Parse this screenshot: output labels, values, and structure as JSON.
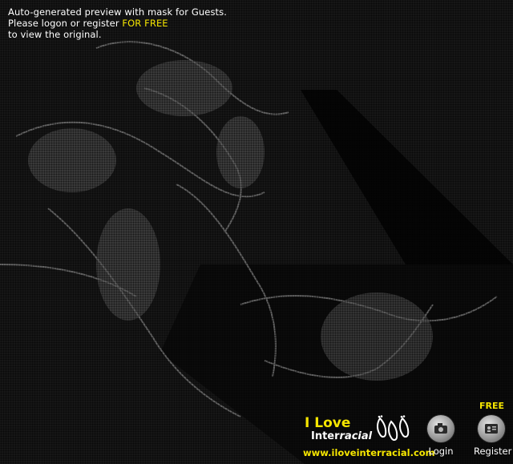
{
  "notice": {
    "line1": "Auto-generated preview with mask for Guests.",
    "line2_prefix": "Please logon or register ",
    "line2_highlight": "FOR FREE",
    "line3": "to view the original."
  },
  "brand": {
    "title": "I Love",
    "subtitle_prefix": "Inter",
    "subtitle_accent": "racial",
    "url": "www.iloveinterracial.com"
  },
  "nav": {
    "free_tag": "FREE",
    "login_label": "Login",
    "register_label": "Register"
  },
  "colors": {
    "accent": "#f5e500",
    "text": "#ffffff",
    "background": "#111111"
  },
  "icons": {
    "login": "camera-icon",
    "register": "id-card-icon",
    "footprints": "footprints-icon"
  }
}
